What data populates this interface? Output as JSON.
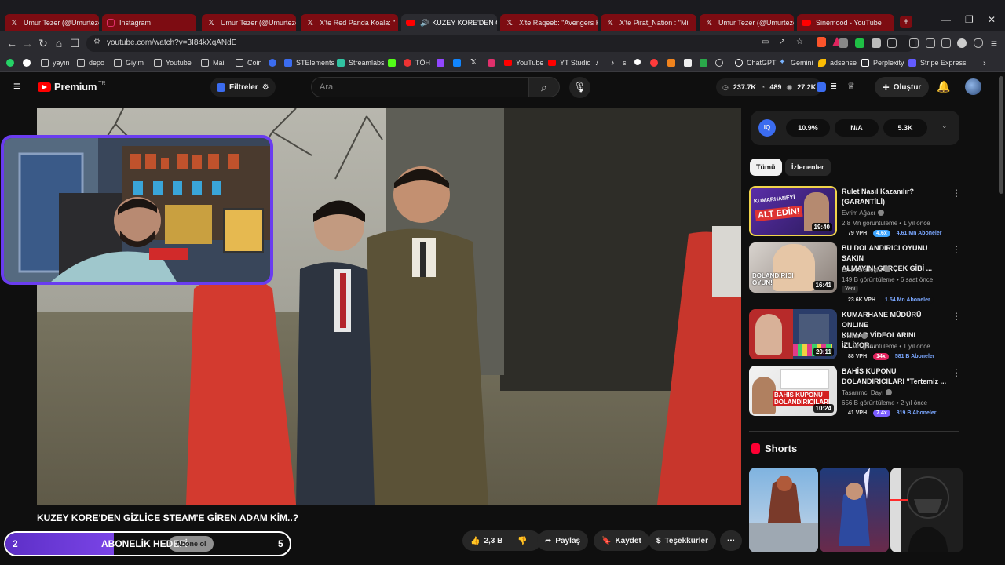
{
  "tabs": [
    {
      "label": "Umur Tezer (@Umurtezer)",
      "icon": "x-icon",
      "active": false
    },
    {
      "label": "Instagram",
      "icon": "instagram-icon",
      "active": false
    },
    {
      "label": "Umur Tezer (@Umurtezer)",
      "icon": "x-icon",
      "active": false
    },
    {
      "label": "X'te Red Panda Koala: \"",
      "icon": "x-icon",
      "active": false
    },
    {
      "label": "KUZEY KORE'DEN G",
      "icon": "youtube-icon",
      "active": true
    },
    {
      "label": "X'te Raqeeb: \"Avengers Ko",
      "icon": "x-icon",
      "active": false
    },
    {
      "label": "X'te Pirat_Nation : \"Mi",
      "icon": "x-icon",
      "active": false
    },
    {
      "label": "Umur Tezer (@Umurtezer)",
      "icon": "x-icon",
      "active": false
    },
    {
      "label": "Sinemood - YouTube",
      "icon": "youtube-icon",
      "active": false
    }
  ],
  "address": {
    "url": "youtube.com/watch?v=3I84kXqANdE"
  },
  "bookmarks": [
    {
      "label": "",
      "icon": "whatsapp-icon",
      "color": "#25d366"
    },
    {
      "label": "",
      "icon": "google-icon",
      "color": "#ffffff"
    },
    {
      "label": "yayın",
      "icon": "folder-icon",
      "color": ""
    },
    {
      "label": "depo",
      "icon": "folder-icon",
      "color": ""
    },
    {
      "label": "Giyim",
      "icon": "folder-icon",
      "color": ""
    },
    {
      "label": "Youtube",
      "icon": "folder-icon",
      "color": ""
    },
    {
      "label": "Mail",
      "icon": "folder-icon",
      "color": ""
    },
    {
      "label": "Coin",
      "icon": "folder-icon",
      "color": ""
    },
    {
      "label": "",
      "icon": "bookmark-r-icon",
      "color": "#3b6cf0"
    },
    {
      "label": "STElements",
      "icon": "stelements-icon",
      "color": "#3b6cf0"
    },
    {
      "label": "Streamlabs",
      "icon": "streamlabs-icon",
      "color": "#31c3a2"
    },
    {
      "label": "",
      "icon": "kick-icon",
      "color": "#53fc18"
    },
    {
      "label": "TÖH",
      "icon": "toh-icon",
      "color": "#e33"
    },
    {
      "label": "",
      "icon": "twitch-icon",
      "color": "#9146ff"
    },
    {
      "label": "",
      "icon": "bluesky-icon",
      "color": "#1185fe"
    },
    {
      "label": "",
      "icon": "x-icon",
      "color": "#ffffff"
    },
    {
      "label": "",
      "icon": "instagram-icon",
      "color": "#e1306c"
    },
    {
      "label": "YouTube",
      "icon": "youtube-icon",
      "color": "#ff0000"
    },
    {
      "label": "YT Studio",
      "icon": "yt-studio-icon",
      "color": "#ff0000"
    },
    {
      "label": "",
      "icon": "tiktok-icon",
      "color": "#ffffff"
    },
    {
      "label": "s",
      "icon": "tiktok-icon",
      "color": "#ffffff"
    },
    {
      "label": "",
      "icon": "bookmark-circle-icon",
      "color": "#ffffff"
    },
    {
      "label": "",
      "icon": "bookmark-red-icon",
      "color": "#ff3b3b"
    },
    {
      "label": "",
      "icon": "bookmark-rss-icon",
      "color": "#f0831d"
    },
    {
      "label": "",
      "icon": "bookmark-b-icon",
      "color": "#eeeeee"
    },
    {
      "label": "",
      "icon": "bookmark-green-icon",
      "color": "#2aa84a"
    },
    {
      "label": "ChatGPT",
      "icon": "chatgpt-icon",
      "color": "#ffffff"
    },
    {
      "label": "Gemini",
      "icon": "gemini-icon",
      "color": "#7ab4ff"
    },
    {
      "label": "adsense",
      "icon": "adsense-icon",
      "color": "#fbbc04"
    },
    {
      "label": "Perplexity",
      "icon": "perplexity-icon",
      "color": "#ffffff"
    },
    {
      "label": "Stripe Express",
      "icon": "stripe-icon",
      "color": "#635bff"
    }
  ],
  "header": {
    "logo_word": "Premium",
    "logo_sup": "TR",
    "filters_label": "Filtreler",
    "search_placeholder": "Ara",
    "stat_views": "237.7K",
    "stat_likes": "489",
    "stat_other": "27.2K",
    "create_label": "Oluştur"
  },
  "video": {
    "title": "KUZEY KORE'DEN GİZLİCE STEAM'E GİREN ADAM KİM..?",
    "goal_label": "ABONELİK HEDEFİ",
    "goal_start": "2",
    "goal_end": "5",
    "goal_progress": 0.38,
    "goal_overlay_text": "Abone ol",
    "like_count": "2,3 B",
    "share_label": "Paylaş",
    "save_label": "Kaydet",
    "thanks_label": "Teşekkürler"
  },
  "ext_panel": {
    "pill1": "10.9%",
    "pill2": "N/A",
    "pill3": "5.3K"
  },
  "chips": {
    "all": "Tümü",
    "watched": "İzlenenler"
  },
  "recommendations": [
    {
      "title_line1": "Rulet Nasıl Kazanılır?",
      "title_line2": "(GARANTİLİ)",
      "channel": "Evrim Ağacı",
      "meta": "2,8 Mn görüntüleme • 1 yıl önce",
      "duration": "19:40",
      "thumb_text": "ALT EDİN!",
      "thumb_small": "KUMARHANEYİ",
      "badge_vph": "79 VPH",
      "badge_mult": "4.6x",
      "badge_subs": "4.61 Mn Aboneler",
      "mult_color": "#3ea6ff",
      "extra": ""
    },
    {
      "title_line1": "BU DOLANDIRICI OYUNU SAKIN",
      "title_line2": "ALMAYIN! GERÇEK GİBİ ...",
      "channel": "Enis Kirazoglu",
      "meta": "149 B görüntüleme • 6 saat önce",
      "duration": "16:41",
      "thumb_text": "DOLANDIRICI OYUN!",
      "thumb_small": "",
      "badge_vph": "23.6K VPH",
      "badge_mult": "",
      "badge_subs": "1.54 Mn Aboneler",
      "mult_color": "",
      "extra": "Yeni"
    },
    {
      "title_line1": "KUMARHANE MÜDÜRÜ ONLINE",
      "title_line2": "KUMAR VİDEOLARINI İZLİYOR...",
      "channel": "Literat",
      "meta": "2,1 Mn görüntüleme • 1 yıl önce",
      "duration": "20:11",
      "thumb_text": "",
      "thumb_small": "",
      "badge_vph": "88 VPH",
      "badge_mult": "14x",
      "badge_subs": "581 B Aboneler",
      "mult_color": "#e0245e",
      "extra": ""
    },
    {
      "title_line1": "BAHİS KUPONU",
      "title_line2": "DOLANDIRICILARI \"Tertemiz ...",
      "channel": "Tasarımcı Dayı",
      "meta": "656 B görüntüleme • 2 yıl önce",
      "duration": "10:24",
      "thumb_text": "BAHİS KUPONU DOLANDIRICILARI",
      "thumb_small": "",
      "badge_vph": "41 VPH",
      "badge_mult": "7.4x",
      "badge_subs": "819 B Aboneler",
      "mult_color": "#7b5cff",
      "extra": ""
    }
  ],
  "shorts": {
    "title": "Shorts"
  },
  "colors": {
    "tab_bg": "#7d0c12",
    "yt_red": "#ff0000",
    "goal_purple": "#6a3cf0",
    "chrome": "#2b2b30"
  }
}
